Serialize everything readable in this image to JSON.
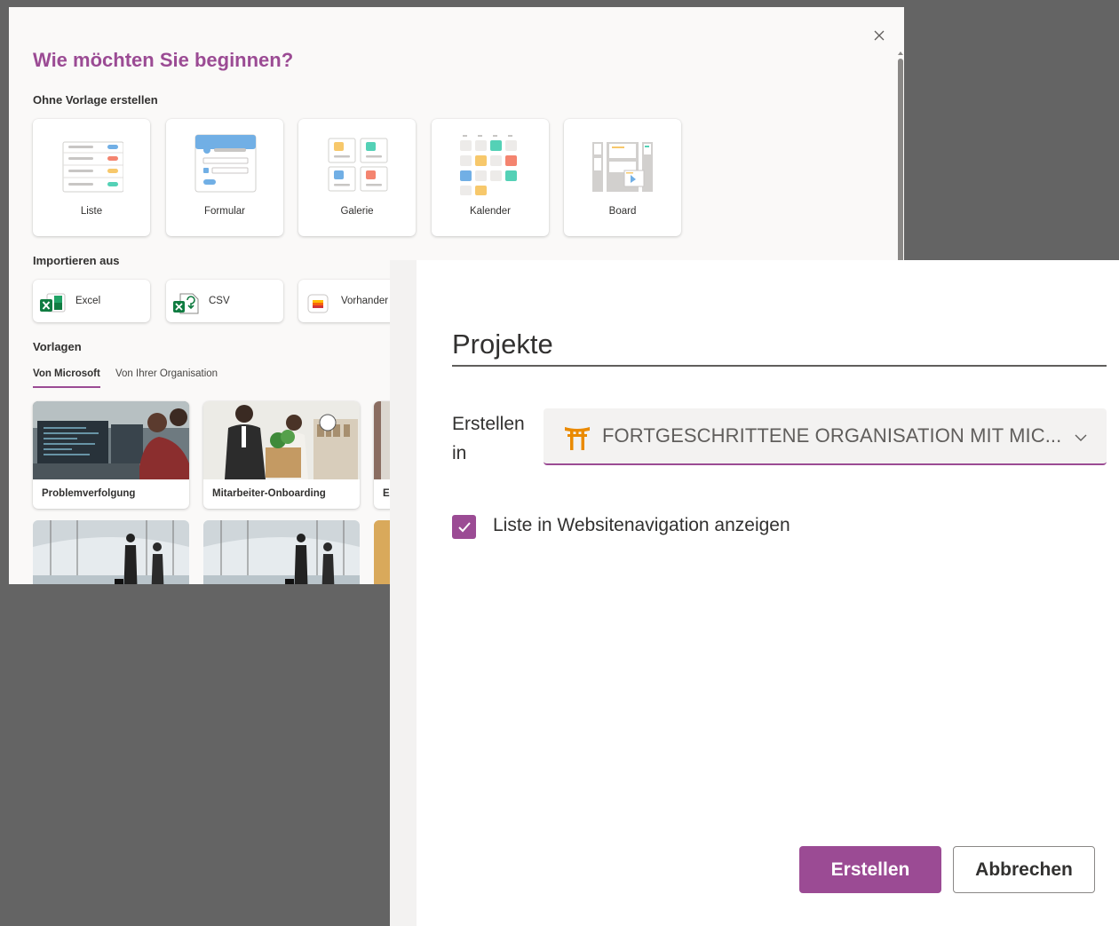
{
  "dialog": {
    "title": "Wie möchten Sie beginnen?",
    "close_icon": "close-icon",
    "blank_section": "Ohne Vorlage erstellen",
    "blank_cards": [
      {
        "label": "Liste",
        "icon": "list-thumbnail-icon"
      },
      {
        "label": "Formular",
        "icon": "form-thumbnail-icon"
      },
      {
        "label": "Galerie",
        "icon": "gallery-thumbnail-icon"
      },
      {
        "label": "Kalender",
        "icon": "calendar-thumbnail-icon"
      },
      {
        "label": "Board",
        "icon": "board-thumbnail-icon"
      }
    ],
    "import_section": "Importieren aus",
    "import_cards": [
      {
        "label": "Excel",
        "icon": "excel-icon"
      },
      {
        "label": "CSV",
        "icon": "csv-icon"
      },
      {
        "label": "Vorhander",
        "icon": "existing-list-icon"
      }
    ],
    "templates_section": "Vorlagen",
    "tabs": [
      "Von Microsoft",
      "Von Ihrer Organisation"
    ],
    "active_tab": "Von Microsoft",
    "templates": [
      {
        "label": "Problemverfolgung"
      },
      {
        "label": "Mitarbeiter-Onboarding"
      },
      {
        "label": "Er"
      }
    ]
  },
  "panel": {
    "list_name": "Projekte",
    "create_in_label": "Erstellen in",
    "site_name": "FORTGESCHRITTENE ORGANISATION MIT MIC...",
    "site_icon": "torii-gate-icon",
    "show_in_nav_label": "Liste in Websitenavigation anzeigen",
    "show_in_nav_checked": true,
    "create_button": "Erstellen",
    "cancel_button": "Abbrechen"
  },
  "colors": {
    "accent": "#9b4b94",
    "overlay": "#646464",
    "dialog_bg": "#faf9f8",
    "dropdown_bg": "#f3f2f1"
  }
}
